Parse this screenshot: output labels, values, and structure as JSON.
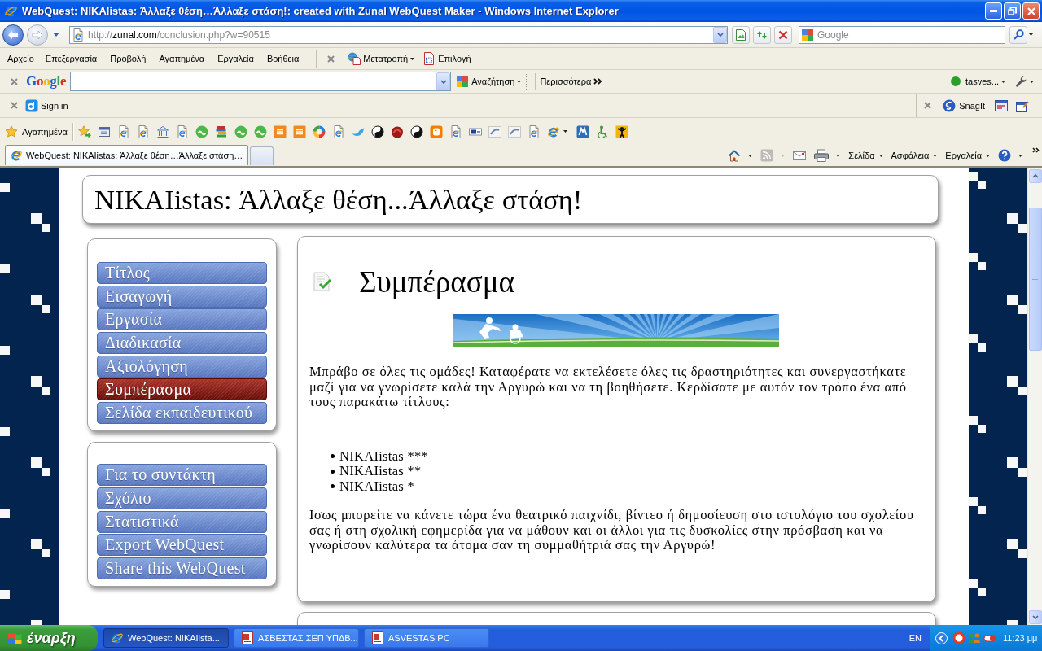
{
  "window": {
    "title": "WebQuest: NIKAIistas: Άλλαξε θέση…Άλλαξε στάση!: created with Zunal WebQuest Maker - Windows Internet Explorer"
  },
  "address_bar": {
    "url": {
      "scheme": "http://",
      "host": "zunal.com",
      "path": "/conclusion.php?w=90515"
    }
  },
  "search_box": {
    "placeholder": "Google"
  },
  "menu_bar": {
    "items": [
      "Αρχείο",
      "Επεξεργασία",
      "Προβολή",
      "Αγαπημένα",
      "Εργαλεία",
      "Βοήθεια"
    ],
    "addon_buttons": [
      {
        "kind": "convert",
        "label": "Μετατροπή",
        "menu": true
      },
      {
        "kind": "select",
        "label": "Επιλογή",
        "menu": false
      }
    ]
  },
  "google_toolbar": {
    "logo": "Google",
    "search_button": {
      "label": "Αναζήτηση",
      "menu": true
    },
    "more": "Περισσότερα",
    "account": {
      "label": "tasves...",
      "online": true,
      "menu": true
    },
    "settings_menu": true
  },
  "sign_in_toolbar": {
    "sign_in": "Sign in",
    "snagit": "SnagIt"
  },
  "favorites_bar": {
    "label": "Αγαπημένα",
    "links": [
      {
        "kind": "add",
        "menu": false
      },
      {
        "kind": "gallery",
        "menu": false
      },
      {
        "kind": "page",
        "menu": false
      },
      {
        "kind": "page",
        "menu": false
      },
      {
        "kind": "building",
        "menu": false
      },
      {
        "kind": "page",
        "menu": false
      },
      {
        "kind": "disc",
        "menu": false
      },
      {
        "kind": "books",
        "menu": false
      },
      {
        "kind": "disc",
        "menu": false
      },
      {
        "kind": "disc",
        "menu": false
      },
      {
        "kind": "square",
        "menu": false
      },
      {
        "kind": "square",
        "menu": false
      },
      {
        "kind": "ring",
        "menu": false
      },
      {
        "kind": "page",
        "menu": false
      },
      {
        "kind": "bird",
        "menu": false
      },
      {
        "kind": "yinyang",
        "menu": false
      },
      {
        "kind": "blob",
        "menu": false
      },
      {
        "kind": "yinyang",
        "menu": false
      },
      {
        "kind": "blog",
        "menu": false
      },
      {
        "kind": "page",
        "menu": false
      },
      {
        "kind": "badge",
        "menu": false
      },
      {
        "kind": "swoosh",
        "menu": false
      },
      {
        "kind": "swoosh",
        "menu": false
      },
      {
        "kind": "page",
        "menu": false
      },
      {
        "kind": "browser",
        "menu": true
      },
      {
        "kind": "tile",
        "menu": false
      },
      {
        "kind": "wheelchair",
        "menu": false
      },
      {
        "kind": "figure",
        "menu": false
      }
    ]
  },
  "tabs": [
    {
      "title": "WebQuest: NIKAIistas: Άλλαξε θέση…Άλλαξε στάση…",
      "selected": true
    }
  ],
  "command_bar": {
    "items": [
      {
        "kind": "home",
        "menu": true,
        "disabled": false
      },
      {
        "kind": "feeds",
        "menu": true,
        "disabled": true
      },
      {
        "kind": "mail",
        "menu": false,
        "disabled": false
      },
      {
        "kind": "print",
        "menu": true,
        "disabled": false
      },
      {
        "kind": "text",
        "label": "Σελίδα",
        "menu": true,
        "disabled": false
      },
      {
        "kind": "text",
        "label": "Ασφάλεια",
        "menu": true,
        "disabled": false
      },
      {
        "kind": "text",
        "label": "Εργαλεία",
        "menu": true,
        "disabled": false
      },
      {
        "kind": "help",
        "menu": true,
        "disabled": false
      }
    ]
  },
  "page": {
    "title": "NIKAIistas: Άλλαξε θέση...Άλλαξε στάση!",
    "nav_groups": [
      {
        "items": [
          {
            "label": "Τίτλος",
            "selected": false
          },
          {
            "label": "Εισαγωγή",
            "selected": false
          },
          {
            "label": "Εργασία",
            "selected": false
          },
          {
            "label": "Διαδικασία",
            "selected": false
          },
          {
            "label": "Αξιολόγηση",
            "selected": false
          },
          {
            "label": "Συμπέρασμα",
            "selected": true
          },
          {
            "label": "Σελίδα εκπαιδευτικού",
            "selected": false
          }
        ]
      },
      {
        "items": [
          {
            "label": "Για το συντάκτη",
            "selected": false
          },
          {
            "label": "Σχόλιο",
            "selected": false
          },
          {
            "label": "Στατιστικά",
            "selected": false
          },
          {
            "label": "Export WebQuest",
            "selected": false
          },
          {
            "label": "Share this WebQuest",
            "selected": false
          }
        ]
      }
    ],
    "section": {
      "heading": "Συμπέρασμα",
      "intro": "Μπράβο σε όλες τις ομάδες! Καταφέρατε να εκτελέσετε όλες τις δραστηριότητες και συνεργαστήκατε μαζί για να γνωρίσετε καλά την Αργυρώ και να τη βοηθήσετε. Κερδίσατε με αυτόν τον τρόπο ένα από τους παρακάτω τίτλους:",
      "titles": [
        "NIKAIistas ***",
        "NIKAIistas **",
        "NIKAIistas *"
      ],
      "closing": "Ισως μπορείτε να κάνετε τώρα ένα θεατρικό παιχνίδι, βίντεο ή δημοσίευση στο ιστολόγιο του σχολείου σας ή στη σχολική εφημερίδα για να μάθουν και οι άλλοι για τις δυσκολίες στην πρόσβαση και να γνωρίσουν καλύτερα τα άτομα σαν τη συμμαθήτριά σας την Αργυρώ!"
    }
  },
  "taskbar": {
    "start": "έναρξη",
    "tasks": [
      {
        "kind": "browser",
        "label": "WebQuest: NIKAIista...",
        "selected": true
      },
      {
        "kind": "document",
        "label": "ΑΣΒΕΣΤΑΣ ΣΕΠ ΥΠΔΒ...",
        "selected": false
      },
      {
        "kind": "document",
        "label": "ASVESTAS PC",
        "selected": false
      }
    ],
    "language": "EN",
    "clock": "11:23 μμ"
  }
}
